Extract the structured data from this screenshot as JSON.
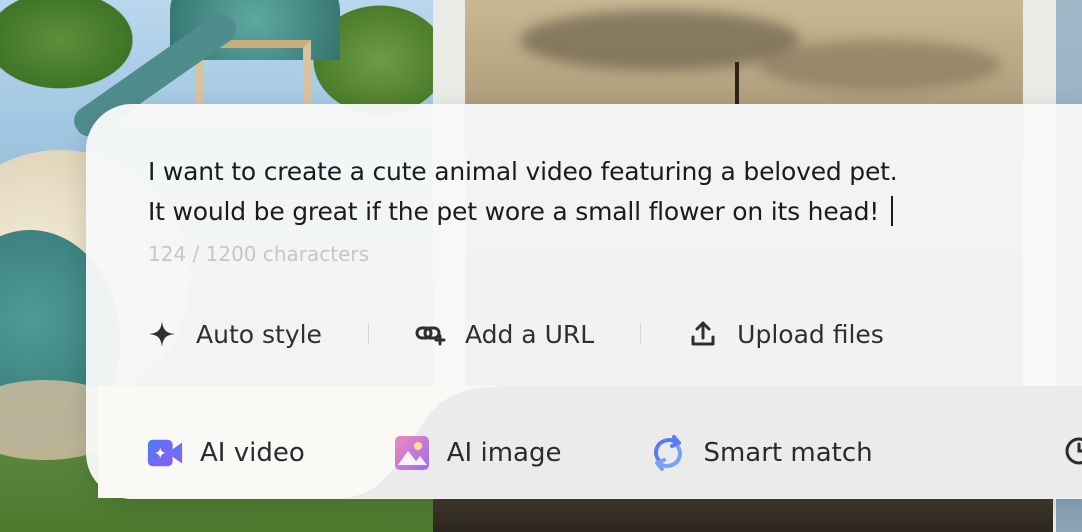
{
  "prompt": {
    "line1": "I want to create a cute animal video featuring a beloved pet.",
    "line2": "It would be great if the pet wore a small flower on its head!",
    "counter": "124 / 1200 characters"
  },
  "tools": [
    {
      "label": "Auto style",
      "icon": "sparkle-icon"
    },
    {
      "label": "Add a URL",
      "icon": "link-add-icon"
    },
    {
      "label": "Upload files",
      "icon": "upload-icon"
    }
  ],
  "tabs": [
    {
      "label": "AI video",
      "icon": "video-camera-icon",
      "color": "#6b5cf6"
    },
    {
      "label": "AI image",
      "icon": "image-icon",
      "color": "#e86bb4"
    },
    {
      "label": "Smart match",
      "icon": "refresh-icon",
      "color": "#5b7cf6"
    },
    {
      "label": "",
      "icon": "clock-icon"
    }
  ],
  "colors": {
    "panel": "#f7f8f8",
    "text": "#1b1b1f",
    "muted": "#c4c6cb"
  }
}
